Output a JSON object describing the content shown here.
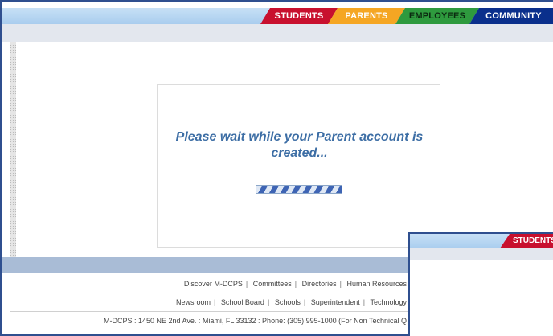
{
  "nav": {
    "tabs": [
      {
        "label": "STUDENTS",
        "color": "#c8102e"
      },
      {
        "label": "PARENTS",
        "color": "#f5a623"
      },
      {
        "label": "EMPLOYEES",
        "color": "#2e9a3e"
      },
      {
        "label": "COMMUNITY",
        "color": "#0a2f8c"
      }
    ]
  },
  "main": {
    "wait_message": "Please wait while your Parent account is created..."
  },
  "footer": {
    "row1": [
      "Discover M-DCPS",
      "Committees",
      "Directories",
      "Human Resources"
    ],
    "row2": [
      "Newsroom",
      "School Board",
      "Schools",
      "Superintendent",
      "Technology"
    ],
    "address": "M-DCPS : 1450 NE 2nd Ave. : Miami, FL 33132 : Phone: (305) 995-1000 (For Non Technical Q"
  },
  "overlay": {
    "tab_label": "STUDENTS"
  }
}
